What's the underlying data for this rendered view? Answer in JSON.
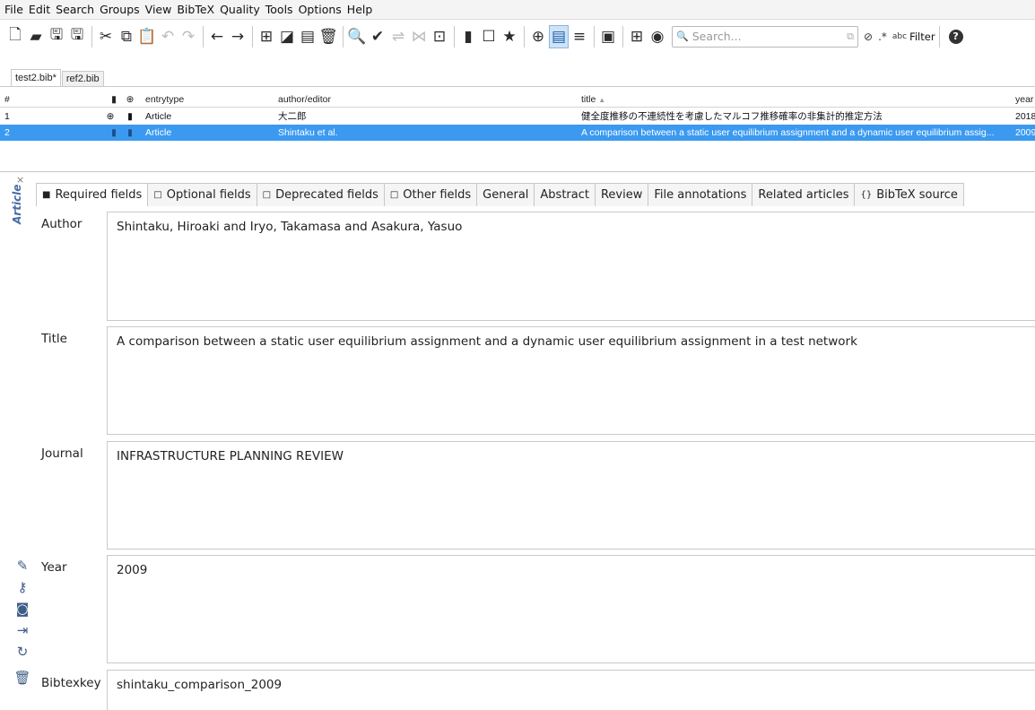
{
  "menu": [
    "File",
    "Edit",
    "Search",
    "Groups",
    "View",
    "BibTeX",
    "Quality",
    "Tools",
    "Options",
    "Help"
  ],
  "search": {
    "placeholder": "Search...",
    "filter_label": "Filter"
  },
  "library_tabs": [
    {
      "label": "test2.bib*",
      "selected": true
    },
    {
      "label": "ref2.bib",
      "selected": false
    }
  ],
  "table": {
    "headers": {
      "num": "#",
      "entrytype": "entrytype",
      "author": "author/editor",
      "title": "title",
      "year": "year"
    },
    "rows": [
      {
        "num": "1",
        "entrytype": "Article",
        "author": "大二郎",
        "title": "健全度推移の不連続性を考慮したマルコフ推移確率の非集計的推定方法",
        "year": "2018"
      },
      {
        "num": "2",
        "entrytype": "Article",
        "author": "Shintaku et al.",
        "title": "A comparison between a static user equilibrium assignment and a dynamic user equilibrium assig...",
        "year": "2009"
      }
    ]
  },
  "entry_type": "Article",
  "editor_tabs": [
    "Required fields",
    "Optional fields",
    "Deprecated fields",
    "Other fields",
    "General",
    "Abstract",
    "Review",
    "File annotations",
    "Related articles",
    "BibTeX source"
  ],
  "fields": [
    {
      "label": "Author",
      "value": "Shintaku, Hiroaki and Iryo, Takamasa and Asakura, Yasuo"
    },
    {
      "label": "Title",
      "value": "A comparison between a static user equilibrium assignment and a dynamic user equilibrium assignment in a test network"
    },
    {
      "label": "Journal",
      "value": "INFRASTRUCTURE PLANNING REVIEW"
    },
    {
      "label": "Year",
      "value": "2009"
    },
    {
      "label": "Bibtexkey",
      "value": "shintaku_comparison_2009"
    }
  ],
  "colors": {
    "selection": "#3b9af0",
    "accent": "#4a6aa5"
  }
}
